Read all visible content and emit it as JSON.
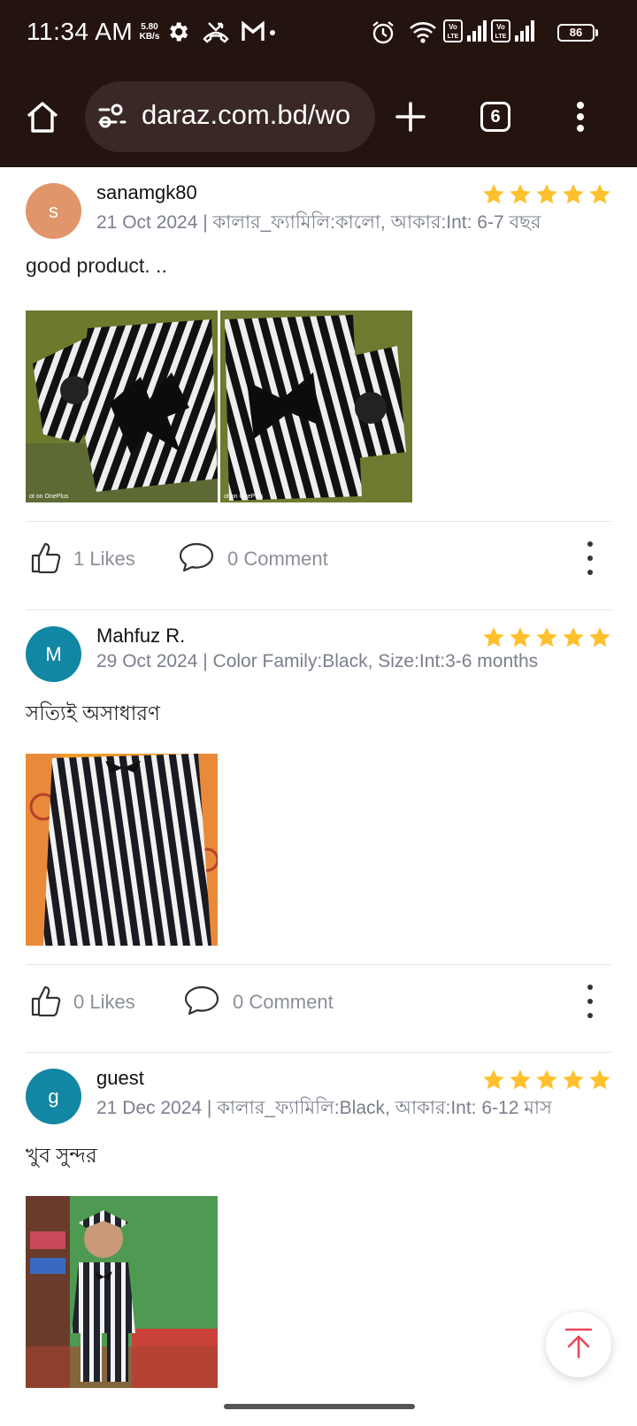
{
  "status_bar": {
    "time": "11:34 AM",
    "net_speed_value": "5.80",
    "net_speed_unit": "KB/s",
    "battery": "86",
    "icons": [
      "settings-icon",
      "missed-call-icon",
      "gmail-icon",
      "alarm-icon",
      "wifi-icon",
      "volte-icon",
      "signal-icon",
      "battery-icon"
    ]
  },
  "browser": {
    "url": "daraz.com.bd/wo",
    "tab_count": "6",
    "icons": [
      "home-icon",
      "site-settings-icon",
      "new-tab-icon",
      "tabs-icon",
      "menu-icon"
    ]
  },
  "reviews": [
    {
      "avatar_letter": "s",
      "avatar_color": "#E0956A",
      "author": "sanamgk80",
      "meta": "21 Oct 2024 | কালার_ফ্যামিলি:কালো, আকার:Int: 6-7 বছর",
      "rating": 5,
      "text": "good product. ..",
      "photo_count": 2,
      "likes": "1 Likes",
      "comments": "0 Comment"
    },
    {
      "avatar_letter": "M",
      "avatar_color": "#1187A3",
      "author": "Mahfuz R.",
      "meta": "29 Oct 2024 | Color Family:Black, Size:Int:3-6 months",
      "rating": 5,
      "text": "সত্যিই অসাধারণ",
      "photo_count": 1,
      "likes": "0 Likes",
      "comments": "0 Comment"
    },
    {
      "avatar_letter": "g",
      "avatar_color": "#1187A3",
      "author": "guest",
      "meta": "21 Dec 2024 | কালার_ফ্যামিলি:Black, আকার:Int: 6-12 মাস",
      "rating": 5,
      "text": "খুব সুন্দর",
      "photo_count": 1,
      "likes": "",
      "comments": ""
    }
  ],
  "colors": {
    "star": "#FFC02D",
    "scroll_top_arrow": "#E8475B",
    "chrome_bg": "#241410"
  },
  "floating": {
    "icon": "arrow-up-to-top-icon"
  }
}
